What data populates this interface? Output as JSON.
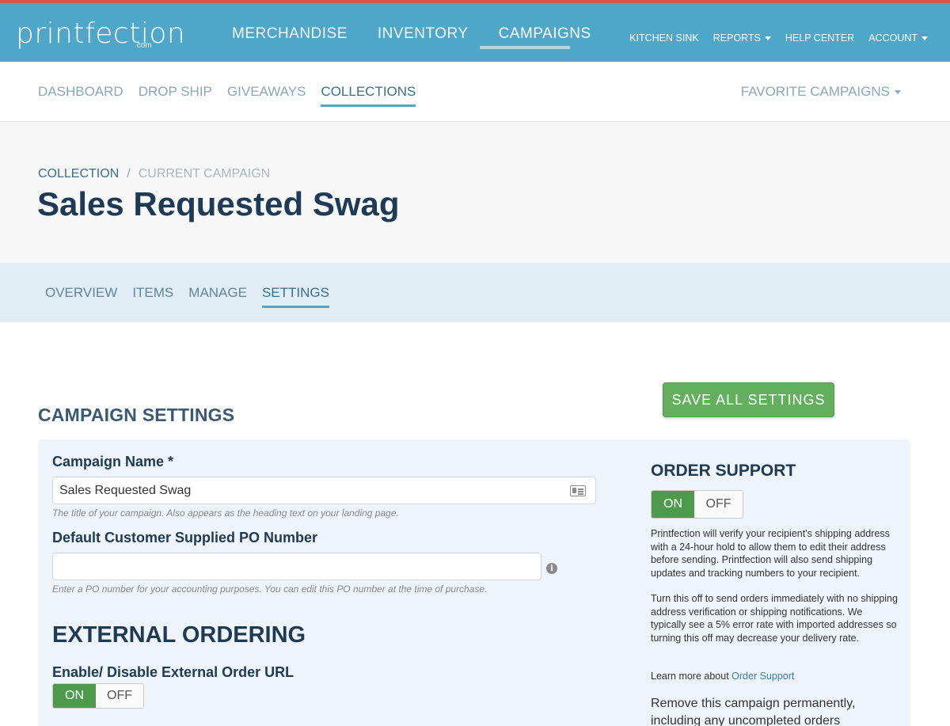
{
  "brand": {
    "logo_text": "printfection",
    "logo_suffix": ".com"
  },
  "main_nav": [
    {
      "label": "MERCHANDISE"
    },
    {
      "label": "INVENTORY"
    },
    {
      "label": "CAMPAIGNS"
    }
  ],
  "util_nav": [
    {
      "label": "KITCHEN SINK"
    },
    {
      "label": "REPORTS"
    },
    {
      "label": "HELP CENTER"
    },
    {
      "label": "ACCOUNT"
    }
  ],
  "sub_nav": [
    {
      "label": "DASHBOARD"
    },
    {
      "label": "DROP SHIP"
    },
    {
      "label": "GIVEAWAYS"
    },
    {
      "label": "COLLECTIONS"
    }
  ],
  "favorite_campaigns": "FAVORITE CAMPAIGNS",
  "breadcrumb": {
    "parent": "COLLECTION",
    "separator": "/",
    "current": "CURRENT CAMPAIGN"
  },
  "page_title": "Sales Requested Swag",
  "tabs": [
    {
      "label": "OVERVIEW"
    },
    {
      "label": "ITEMS"
    },
    {
      "label": "MANAGE"
    },
    {
      "label": "SETTINGS"
    }
  ],
  "section_title": "CAMPAIGN SETTINGS",
  "save_button": "SAVE ALL SETTINGS",
  "form": {
    "campaign_name_label": "Campaign Name *",
    "campaign_name_value": "Sales Requested Swag",
    "campaign_name_help": "The title of your campaign. Also appears as the heading text on your landing page.",
    "po_label": "Default Customer Supplied PO Number",
    "po_value": "",
    "po_help": "Enter a PO number for your accounting purposes. You can edit this PO number at the time of purchase."
  },
  "external_ordering": {
    "title": "EXTERNAL ORDERING",
    "toggle_label": "Enable/ Disable External Order URL",
    "on_label": "ON",
    "off_label": "OFF",
    "state": "on"
  },
  "order_support": {
    "title": "ORDER SUPPORT",
    "on_label": "ON",
    "off_label": "OFF",
    "state": "on",
    "paragraph1": "Printfection will verify your recipient's shipping address with a 24-hour hold to allow them to edit their address before sending. Printfection will also send shipping updates and tracking numbers to your recipient.",
    "paragraph2": "Turn this off to send orders immediately with no shipping address verification or shipping notifications. We typically see a 5% error rate with imported addresses so turning this off may decrease your delivery rate.",
    "learn_more_prefix": "Learn more about",
    "learn_more_link": "Order Support",
    "remove_text": "Remove this campaign permanently, including any uncompleted orders"
  },
  "icons": {
    "card": "id-card-icon",
    "info": "info-icon",
    "caret": "caret-down-icon"
  },
  "colors": {
    "header_bg": "#4ea6c9",
    "accent_red": "#d9534f",
    "save_green": "#62b05e",
    "toggle_on": "#4e9a4c",
    "tabs_bg": "#e1edf5",
    "panel_bg": "#eef4f9"
  }
}
